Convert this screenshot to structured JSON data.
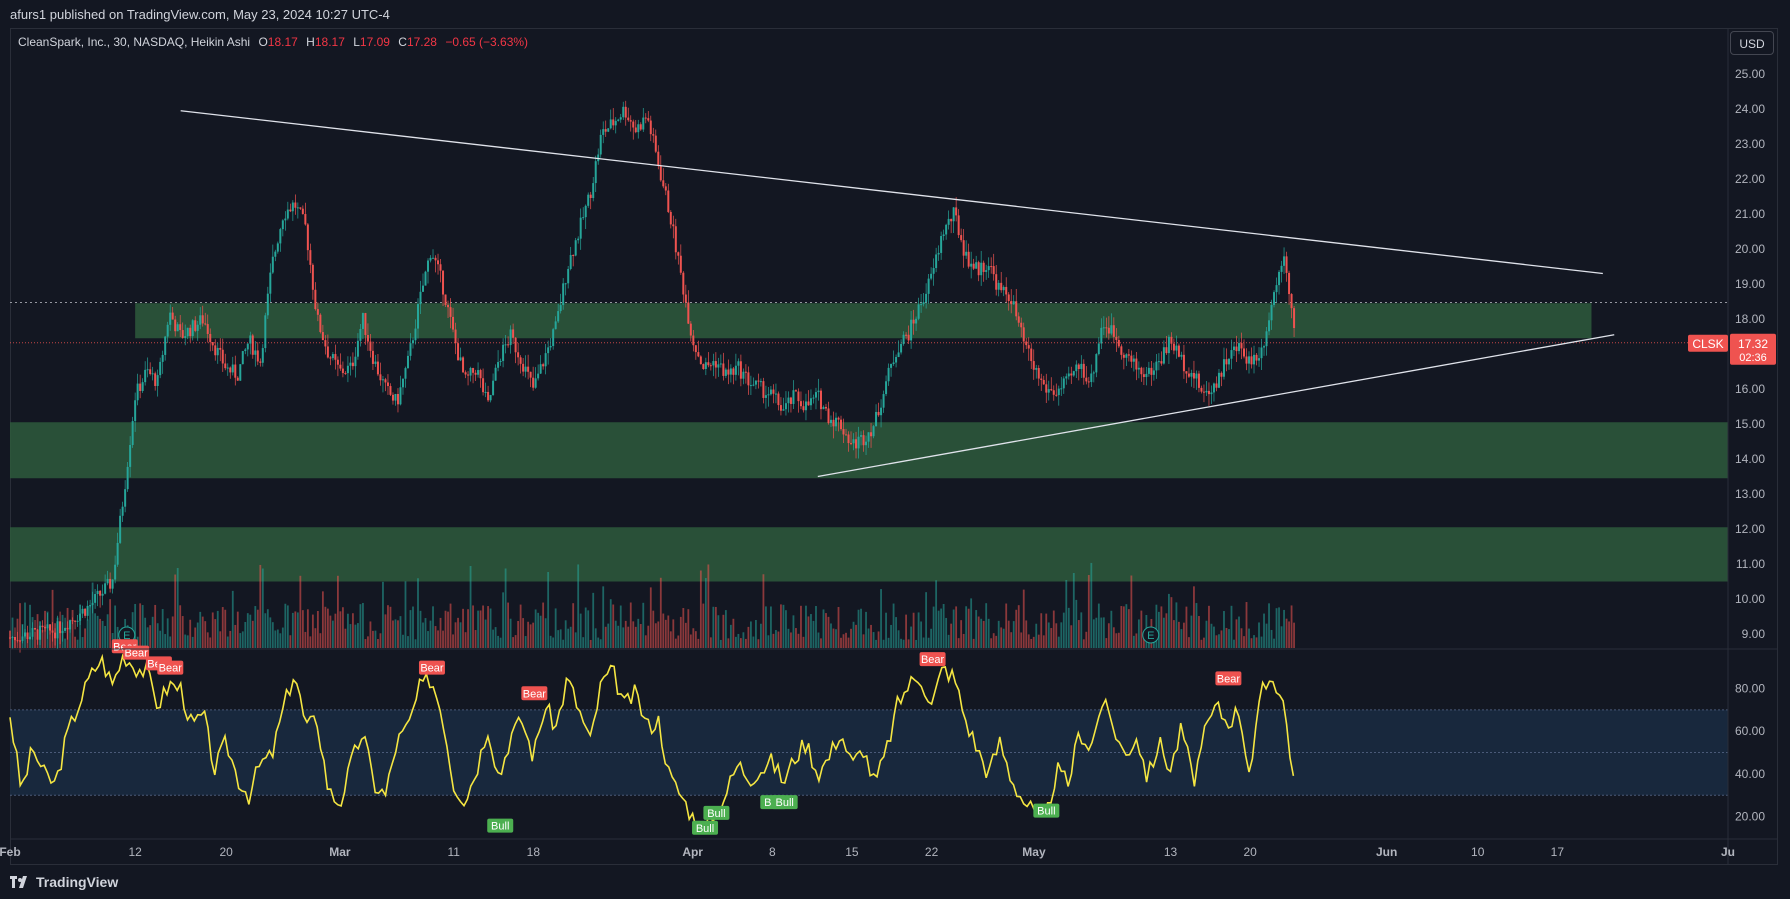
{
  "header": {
    "publisher": "afurs1 published on TradingView.com, May 23, 2024 10:27 UTC-4",
    "symbol": "CleanSpark, Inc., 30, NASDAQ, Heikin Ashi",
    "o_label": "O",
    "o_value": "18.17",
    "h_label": "H",
    "h_value": "18.17",
    "l_label": "L",
    "l_value": "17.09",
    "c_label": "C",
    "c_value": "17.28",
    "change": "−0.65 (−3.63%)",
    "currency": "USD"
  },
  "price_tag": {
    "symbol": "CLSK",
    "price": "17.32",
    "countdown": "02:36"
  },
  "footer": {
    "brand": "TradingView"
  },
  "colors": {
    "bg": "#131722",
    "up": "#26a69a",
    "down": "#ef5350",
    "zone": "#2e5a3c",
    "osc": "#f5e642",
    "band": "#1a2a40",
    "bear": "#ef5350",
    "bull": "#4caf50"
  },
  "chart_data": [
    {
      "type": "candlestick",
      "ylim": [
        8.6,
        25.4
      ],
      "y_ticks": [
        "25.00",
        "24.00",
        "23.00",
        "22.00",
        "21.00",
        "20.00",
        "19.00",
        "18.00",
        "17.00",
        "16.00",
        "15.00",
        "14.00",
        "13.00",
        "12.00",
        "11.00",
        "10.00",
        "9.00"
      ],
      "x_ticks": [
        "Feb",
        "12",
        "20",
        "Mar",
        "11",
        "18",
        "Apr",
        "8",
        "15",
        "22",
        "May",
        "13",
        "20",
        "Jun",
        "10",
        "17",
        "Ju"
      ],
      "x_tick_days": [
        0,
        11,
        19,
        29,
        39,
        46,
        60,
        67,
        74,
        81,
        90,
        102,
        109,
        121,
        129,
        136,
        151
      ],
      "x_range_days": [
        0,
        151
      ],
      "last_data_day": 113,
      "close_series": [
        {
          "d": 0,
          "p": 8.9
        },
        {
          "d": 4,
          "p": 9.1
        },
        {
          "d": 7,
          "p": 9.8
        },
        {
          "d": 9,
          "p": 10.5
        },
        {
          "d": 10,
          "p": 13.0
        },
        {
          "d": 11,
          "p": 15.8
        },
        {
          "d": 12,
          "p": 16.5
        },
        {
          "d": 13,
          "p": 16.2
        },
        {
          "d": 14,
          "p": 18.2
        },
        {
          "d": 15,
          "p": 17.5
        },
        {
          "d": 17,
          "p": 18.0
        },
        {
          "d": 18,
          "p": 17.2
        },
        {
          "d": 19,
          "p": 16.6
        },
        {
          "d": 20,
          "p": 16.4
        },
        {
          "d": 21,
          "p": 17.4
        },
        {
          "d": 22,
          "p": 16.8
        },
        {
          "d": 23,
          "p": 19.5
        },
        {
          "d": 24,
          "p": 21.0
        },
        {
          "d": 25,
          "p": 21.3
        },
        {
          "d": 26,
          "p": 20.6
        },
        {
          "d": 27,
          "p": 18.0
        },
        {
          "d": 28,
          "p": 17.0
        },
        {
          "d": 29,
          "p": 16.5
        },
        {
          "d": 30,
          "p": 16.6
        },
        {
          "d": 31,
          "p": 18.0
        },
        {
          "d": 32,
          "p": 16.8
        },
        {
          "d": 33,
          "p": 16.0
        },
        {
          "d": 34,
          "p": 15.6
        },
        {
          "d": 35,
          "p": 16.8
        },
        {
          "d": 36,
          "p": 18.5
        },
        {
          "d": 37,
          "p": 20.0
        },
        {
          "d": 38,
          "p": 19.0
        },
        {
          "d": 39,
          "p": 17.5
        },
        {
          "d": 40,
          "p": 16.2
        },
        {
          "d": 41,
          "p": 16.6
        },
        {
          "d": 42,
          "p": 15.5
        },
        {
          "d": 43,
          "p": 16.9
        },
        {
          "d": 44,
          "p": 17.5
        },
        {
          "d": 45,
          "p": 16.8
        },
        {
          "d": 46,
          "p": 16.0
        },
        {
          "d": 47,
          "p": 16.9
        },
        {
          "d": 48,
          "p": 17.8
        },
        {
          "d": 49,
          "p": 19.5
        },
        {
          "d": 50,
          "p": 20.5
        },
        {
          "d": 51,
          "p": 21.6
        },
        {
          "d": 52,
          "p": 23.3
        },
        {
          "d": 53,
          "p": 23.6
        },
        {
          "d": 54,
          "p": 24.0
        },
        {
          "d": 55,
          "p": 23.4
        },
        {
          "d": 56,
          "p": 23.8
        },
        {
          "d": 57,
          "p": 22.4
        },
        {
          "d": 58,
          "p": 21.0
        },
        {
          "d": 59,
          "p": 19.2
        },
        {
          "d": 60,
          "p": 17.4
        },
        {
          "d": 61,
          "p": 16.6
        },
        {
          "d": 62,
          "p": 16.8
        },
        {
          "d": 63,
          "p": 16.4
        },
        {
          "d": 64,
          "p": 16.6
        },
        {
          "d": 65,
          "p": 16.2
        },
        {
          "d": 66,
          "p": 16.0
        },
        {
          "d": 67,
          "p": 15.8
        },
        {
          "d": 68,
          "p": 15.4
        },
        {
          "d": 69,
          "p": 15.8
        },
        {
          "d": 70,
          "p": 15.5
        },
        {
          "d": 71,
          "p": 15.8
        },
        {
          "d": 72,
          "p": 15.2
        },
        {
          "d": 73,
          "p": 15.0
        },
        {
          "d": 74,
          "p": 14.4
        },
        {
          "d": 75,
          "p": 14.6
        },
        {
          "d": 76,
          "p": 15.0
        },
        {
          "d": 77,
          "p": 16.2
        },
        {
          "d": 78,
          "p": 17.2
        },
        {
          "d": 79,
          "p": 17.6
        },
        {
          "d": 80,
          "p": 18.4
        },
        {
          "d": 81,
          "p": 19.2
        },
        {
          "d": 82,
          "p": 20.5
        },
        {
          "d": 83,
          "p": 21.0
        },
        {
          "d": 84,
          "p": 19.8
        },
        {
          "d": 85,
          "p": 19.4
        },
        {
          "d": 86,
          "p": 19.6
        },
        {
          "d": 87,
          "p": 18.8
        },
        {
          "d": 88,
          "p": 18.6
        },
        {
          "d": 89,
          "p": 17.4
        },
        {
          "d": 90,
          "p": 16.6
        },
        {
          "d": 91,
          "p": 16.0
        },
        {
          "d": 92,
          "p": 15.9
        },
        {
          "d": 93,
          "p": 16.2
        },
        {
          "d": 94,
          "p": 16.7
        },
        {
          "d": 95,
          "p": 16.2
        },
        {
          "d": 96,
          "p": 17.9
        },
        {
          "d": 97,
          "p": 17.6
        },
        {
          "d": 98,
          "p": 17.0
        },
        {
          "d": 99,
          "p": 16.6
        },
        {
          "d": 100,
          "p": 16.4
        },
        {
          "d": 101,
          "p": 16.8
        },
        {
          "d": 102,
          "p": 17.4
        },
        {
          "d": 103,
          "p": 16.8
        },
        {
          "d": 104,
          "p": 16.4
        },
        {
          "d": 105,
          "p": 15.8
        },
        {
          "d": 106,
          "p": 16.2
        },
        {
          "d": 107,
          "p": 16.9
        },
        {
          "d": 108,
          "p": 17.2
        },
        {
          "d": 109,
          "p": 16.8
        },
        {
          "d": 110,
          "p": 17.1
        },
        {
          "d": 111,
          "p": 18.6
        },
        {
          "d": 112,
          "p": 20.0
        },
        {
          "d": 113,
          "p": 17.28
        }
      ],
      "zones": [
        {
          "from_day": 11,
          "to_day": 139,
          "low": 17.45,
          "high": 18.45
        },
        {
          "from_day": 0,
          "to_day": 151,
          "low": 13.45,
          "high": 15.05
        },
        {
          "from_day": 0,
          "to_day": 151,
          "low": 10.5,
          "high": 12.05
        }
      ],
      "trendlines": [
        {
          "d1": 15,
          "p1": 23.95,
          "d2": 140,
          "p2": 19.3
        },
        {
          "d1": 71,
          "p1": 13.5,
          "d2": 141,
          "p2": 17.55
        }
      ],
      "reference_lines": [
        18.47,
        17.32
      ],
      "markers": [
        {
          "d": 10,
          "label": "E"
        },
        {
          "d": 100,
          "label": "E"
        }
      ]
    },
    {
      "type": "line",
      "name": "oscillator",
      "ylim": [
        10,
        98
      ],
      "y_ticks": [
        "80.00",
        "60.00",
        "40.00",
        "20.00"
      ],
      "band": [
        30,
        70
      ],
      "mid_line": 50,
      "values_by_day": [
        {
          "d": 0,
          "v": 68
        },
        {
          "d": 1,
          "v": 32
        },
        {
          "d": 2,
          "v": 52
        },
        {
          "d": 3,
          "v": 40
        },
        {
          "d": 4,
          "v": 35
        },
        {
          "d": 5,
          "v": 58
        },
        {
          "d": 6,
          "v": 72
        },
        {
          "d": 7,
          "v": 85
        },
        {
          "d": 8,
          "v": 94
        },
        {
          "d": 9,
          "v": 82
        },
        {
          "d": 10,
          "v": 96
        },
        {
          "d": 11,
          "v": 90
        },
        {
          "d": 12,
          "v": 88
        },
        {
          "d": 13,
          "v": 72
        },
        {
          "d": 14,
          "v": 82
        },
        {
          "d": 15,
          "v": 80
        },
        {
          "d": 16,
          "v": 62
        },
        {
          "d": 17,
          "v": 68
        },
        {
          "d": 18,
          "v": 42
        },
        {
          "d": 19,
          "v": 55
        },
        {
          "d": 20,
          "v": 38
        },
        {
          "d": 21,
          "v": 30
        },
        {
          "d": 22,
          "v": 45
        },
        {
          "d": 23,
          "v": 48
        },
        {
          "d": 24,
          "v": 70
        },
        {
          "d": 25,
          "v": 88
        },
        {
          "d": 26,
          "v": 62
        },
        {
          "d": 27,
          "v": 65
        },
        {
          "d": 28,
          "v": 32
        },
        {
          "d": 29,
          "v": 26
        },
        {
          "d": 30,
          "v": 45
        },
        {
          "d": 31,
          "v": 60
        },
        {
          "d": 32,
          "v": 35
        },
        {
          "d": 33,
          "v": 30
        },
        {
          "d": 34,
          "v": 55
        },
        {
          "d": 35,
          "v": 62
        },
        {
          "d": 36,
          "v": 80
        },
        {
          "d": 37,
          "v": 85
        },
        {
          "d": 38,
          "v": 68
        },
        {
          "d": 39,
          "v": 35
        },
        {
          "d": 40,
          "v": 28
        },
        {
          "d": 41,
          "v": 42
        },
        {
          "d": 42,
          "v": 62
        },
        {
          "d": 43,
          "v": 38
        },
        {
          "d": 44,
          "v": 58
        },
        {
          "d": 45,
          "v": 65
        },
        {
          "d": 46,
          "v": 48
        },
        {
          "d": 47,
          "v": 72
        },
        {
          "d": 48,
          "v": 62
        },
        {
          "d": 49,
          "v": 85
        },
        {
          "d": 50,
          "v": 70
        },
        {
          "d": 51,
          "v": 55
        },
        {
          "d": 52,
          "v": 83
        },
        {
          "d": 53,
          "v": 88
        },
        {
          "d": 54,
          "v": 72
        },
        {
          "d": 55,
          "v": 78
        },
        {
          "d": 56,
          "v": 62
        },
        {
          "d": 57,
          "v": 65
        },
        {
          "d": 58,
          "v": 38
        },
        {
          "d": 59,
          "v": 30
        },
        {
          "d": 60,
          "v": 20
        },
        {
          "d": 61,
          "v": 14
        },
        {
          "d": 62,
          "v": 22
        },
        {
          "d": 63,
          "v": 32
        },
        {
          "d": 64,
          "v": 45
        },
        {
          "d": 65,
          "v": 38
        },
        {
          "d": 66,
          "v": 42
        },
        {
          "d": 67,
          "v": 46
        },
        {
          "d": 68,
          "v": 36
        },
        {
          "d": 69,
          "v": 48
        },
        {
          "d": 70,
          "v": 55
        },
        {
          "d": 71,
          "v": 40
        },
        {
          "d": 72,
          "v": 48
        },
        {
          "d": 73,
          "v": 60
        },
        {
          "d": 74,
          "v": 44
        },
        {
          "d": 75,
          "v": 52
        },
        {
          "d": 76,
          "v": 35
        },
        {
          "d": 77,
          "v": 50
        },
        {
          "d": 78,
          "v": 72
        },
        {
          "d": 79,
          "v": 82
        },
        {
          "d": 80,
          "v": 86
        },
        {
          "d": 81,
          "v": 72
        },
        {
          "d": 82,
          "v": 90
        },
        {
          "d": 83,
          "v": 85
        },
        {
          "d": 84,
          "v": 65
        },
        {
          "d": 85,
          "v": 52
        },
        {
          "d": 86,
          "v": 40
        },
        {
          "d": 87,
          "v": 55
        },
        {
          "d": 88,
          "v": 38
        },
        {
          "d": 89,
          "v": 28
        },
        {
          "d": 90,
          "v": 22
        },
        {
          "d": 91,
          "v": 18
        },
        {
          "d": 92,
          "v": 42
        },
        {
          "d": 93,
          "v": 35
        },
        {
          "d": 94,
          "v": 60
        },
        {
          "d": 95,
          "v": 52
        },
        {
          "d": 96,
          "v": 74
        },
        {
          "d": 97,
          "v": 62
        },
        {
          "d": 98,
          "v": 48
        },
        {
          "d": 99,
          "v": 58
        },
        {
          "d": 100,
          "v": 38
        },
        {
          "d": 101,
          "v": 55
        },
        {
          "d": 102,
          "v": 42
        },
        {
          "d": 103,
          "v": 62
        },
        {
          "d": 104,
          "v": 36
        },
        {
          "d": 105,
          "v": 58
        },
        {
          "d": 106,
          "v": 72
        },
        {
          "d": 107,
          "v": 64
        },
        {
          "d": 108,
          "v": 70
        },
        {
          "d": 109,
          "v": 40
        },
        {
          "d": 110,
          "v": 78
        },
        {
          "d": 111,
          "v": 86
        },
        {
          "d": 112,
          "v": 72
        },
        {
          "d": 113,
          "v": 30
        }
      ],
      "signals": [
        {
          "d": 10,
          "label": "Bear",
          "v": 96
        },
        {
          "d": 11,
          "label": "Bear",
          "v": 93
        },
        {
          "d": 13,
          "label": "Bear",
          "v": 88
        },
        {
          "d": 14,
          "label": "Bear",
          "v": 86
        },
        {
          "d": 37,
          "label": "Bear",
          "v": 86
        },
        {
          "d": 46,
          "label": "Bear",
          "v": 74
        },
        {
          "d": 81,
          "label": "Bear",
          "v": 90
        },
        {
          "d": 107,
          "label": "Bear",
          "v": 81
        },
        {
          "d": 43,
          "label": "Bull",
          "v": 20
        },
        {
          "d": 61,
          "label": "Bull",
          "v": 19
        },
        {
          "d": 62,
          "label": "Bull",
          "v": 26
        },
        {
          "d": 67,
          "label": "Bull",
          "v": 31
        },
        {
          "d": 68,
          "label": "Bull",
          "v": 31
        },
        {
          "d": 91,
          "label": "Bull",
          "v": 27
        }
      ]
    }
  ]
}
